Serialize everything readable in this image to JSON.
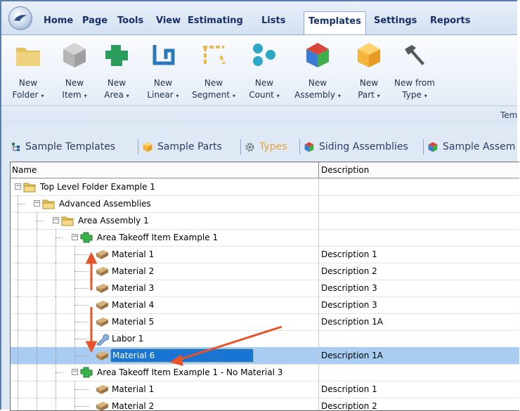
{
  "menu": {
    "tabs": [
      {
        "label": "Home"
      },
      {
        "label": "Page"
      },
      {
        "label": "Tools"
      },
      {
        "label": "View"
      },
      {
        "label": "Estimating"
      },
      {
        "label": "Lists"
      },
      {
        "label": "Templates",
        "active": true
      },
      {
        "label": "Settings"
      },
      {
        "label": "Reports"
      }
    ]
  },
  "ribbon": {
    "buttons": [
      {
        "line1": "New",
        "line2": "Folder",
        "icon": "folder-icon"
      },
      {
        "line1": "New",
        "line2": "Item",
        "icon": "cube-gray-icon"
      },
      {
        "line1": "New",
        "line2": "Area",
        "icon": "area-shape-icon"
      },
      {
        "line1": "New",
        "line2": "Linear",
        "icon": "linear-shape-icon"
      },
      {
        "line1": "New",
        "line2": "Segment",
        "icon": "segment-shape-icon"
      },
      {
        "line1": "New",
        "line2": "Count",
        "icon": "count-dots-icon"
      },
      {
        "line1": "New",
        "line2": "Assembly",
        "icon": "assembly-cube-icon"
      },
      {
        "line1": "New",
        "line2": "Part",
        "icon": "part-cube-icon"
      },
      {
        "line1": "New from",
        "line2": "Type",
        "icon": "hammer-icon"
      }
    ],
    "group_caption": "Tem"
  },
  "doc_tabs": [
    {
      "label": "Sample Templates",
      "icon": "tree-icon"
    },
    {
      "label": "Sample Parts",
      "icon": "part-cube-icon"
    },
    {
      "label": "Types",
      "icon": "gear-icon",
      "active": true
    },
    {
      "label": "Siding Assemblies",
      "icon": "assembly-cube-icon"
    },
    {
      "label": "Sample Assem",
      "icon": "assembly-cube-icon"
    }
  ],
  "grid": {
    "columns": {
      "name": "Name",
      "description": "Description"
    },
    "rows": [
      {
        "name": "Top Level Folder Example 1",
        "description": "",
        "level": 0,
        "type": "folder",
        "expanded": true
      },
      {
        "name": "Advanced Assemblies",
        "description": "",
        "level": 1,
        "type": "folder",
        "expanded": true
      },
      {
        "name": "Area Assembly 1",
        "description": "",
        "level": 2,
        "type": "folder",
        "expanded": true
      },
      {
        "name": "Area Takeoff Item Example 1",
        "description": "",
        "level": 3,
        "type": "area",
        "expanded": true
      },
      {
        "name": "Material 1",
        "description": "Description 1",
        "level": 4,
        "type": "material"
      },
      {
        "name": "Material 2",
        "description": "Description 2",
        "level": 4,
        "type": "material"
      },
      {
        "name": "Material 3",
        "description": "Description 3",
        "level": 4,
        "type": "material"
      },
      {
        "name": "Material 4",
        "description": "Description 3",
        "level": 4,
        "type": "material"
      },
      {
        "name": "Material 5",
        "description": "Description 1A",
        "level": 4,
        "type": "material"
      },
      {
        "name": "Labor 1",
        "description": "",
        "level": 4,
        "type": "labor"
      },
      {
        "name": "Material 6",
        "description": "Description 1A",
        "level": 4,
        "type": "material",
        "selected": true
      },
      {
        "name": "Area Takeoff Item Example 1 - No Material 3",
        "description": "",
        "level": 3,
        "type": "area",
        "expanded": true
      },
      {
        "name": "Material 1",
        "description": "Description 1",
        "level": 4,
        "type": "material"
      },
      {
        "name": "Material 2",
        "description": "Description 2",
        "level": 4,
        "type": "material"
      }
    ]
  },
  "colors": {
    "accent": "#e8542a",
    "selection": "#1a75d2",
    "menu_text": "#15306a"
  }
}
